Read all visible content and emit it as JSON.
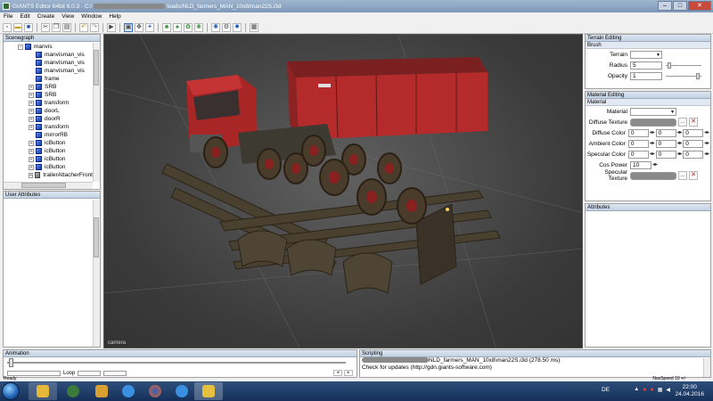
{
  "window": {
    "title_prefix": "GIANTS Editor 64bit 6.0.3 - C:/",
    "title_suffix": "loads/NLD_farmers_MAN_10x8/man22S.i3d",
    "min": "–",
    "max": "□",
    "close": "✕"
  },
  "menu": {
    "file": "File",
    "edit": "Edit",
    "create": "Create",
    "view": "View",
    "window": "Window",
    "help": "Help"
  },
  "scenegraph": {
    "title": "Scenegraph",
    "items": [
      {
        "label": "manvis",
        "icon": "cube-icon",
        "expander": "−"
      },
      {
        "label": "manvisman_vis",
        "icon": "cube-icon",
        "expander": ""
      },
      {
        "label": "manvisman_vis",
        "icon": "cube-icon",
        "expander": ""
      },
      {
        "label": "manvisman_vis",
        "icon": "cube-icon",
        "expander": ""
      },
      {
        "label": "frame",
        "icon": "cube-icon",
        "expander": ""
      },
      {
        "label": "SRB",
        "icon": "cube-icon",
        "expander": "+"
      },
      {
        "label": "SRB",
        "icon": "cube-icon",
        "expander": "+"
      },
      {
        "label": "transform",
        "icon": "cube-icon",
        "expander": "+"
      },
      {
        "label": "doorL",
        "icon": "cube-icon",
        "expander": "+"
      },
      {
        "label": "doorR",
        "icon": "cube-icon",
        "expander": "+"
      },
      {
        "label": "transform",
        "icon": "cube-icon",
        "expander": "+"
      },
      {
        "label": "mirrorRB",
        "icon": "cube-icon",
        "expander": ""
      },
      {
        "label": "icButton",
        "icon": "cube-icon",
        "expander": "+"
      },
      {
        "label": "icButton",
        "icon": "cube-icon",
        "expander": "+"
      },
      {
        "label": "icButton",
        "icon": "cube-icon",
        "expander": "+"
      },
      {
        "label": "icButton",
        "icon": "cube-icon",
        "expander": "+"
      },
      {
        "label": "trailerAttacherFront",
        "icon": "attacher-icon",
        "expander": "+"
      }
    ]
  },
  "user_attributes": {
    "title": "User Attributes"
  },
  "viewport": {
    "camera_label": "camera"
  },
  "terrain_editing": {
    "title": "Terrain Editing",
    "section": "Brush",
    "terrain_label": "Terrain",
    "radius_label": "Radius",
    "radius_value": "5",
    "opacity_label": "Opacity",
    "opacity_value": "1"
  },
  "material_editing": {
    "title": "Material Editing",
    "section": "Material",
    "material_label": "Material",
    "diffuse_texture_label": "Diffuse Texture",
    "diffuse_color_label": "Diffuse Color",
    "ambient_color_label": "Ambient Color",
    "specular_color_label": "Specular Color",
    "cos_power_label": "Cos Power",
    "cos_power_value": "10",
    "specular_texture_label": "Specular Texture",
    "zero": "0",
    "browse": "...",
    "remove": "✕"
  },
  "attributes": {
    "title": "Attributes"
  },
  "animation": {
    "title": "Animation",
    "loop_label": "Loop "
  },
  "scripting": {
    "title": "Scripting",
    "line1_suffix": "NLD_farmers_MAN_10x8\\man22S.i3d (278.50 ms)",
    "line2": "Check for updates (http://gdn.giants-software.com)"
  },
  "status": {
    "ready": "Ready",
    "nav_speed": "NavSpeed 10 +/-"
  },
  "taskbar": {
    "lang": "DE",
    "time": "22:00",
    "date": "24.04.2016"
  },
  "colors": {
    "title_gradient_top": "#9fb5cf",
    "taskbar": "#1e3f6c",
    "viewport_bg": "#4a4a4a",
    "truck_red": "#b52a2a"
  }
}
